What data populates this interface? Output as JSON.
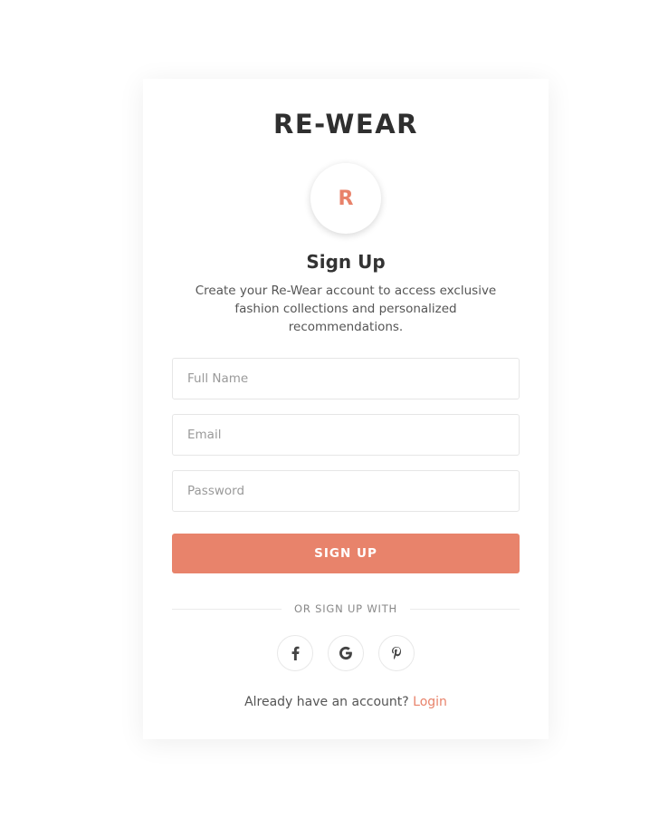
{
  "brand": {
    "name": "RE-WEAR",
    "logo_letter": "R"
  },
  "signup": {
    "title": "Sign Up",
    "subtitle": "Create your Re-Wear account to access exclusive fashion collections and personalized recommendations."
  },
  "form": {
    "full_name": {
      "placeholder": "Full Name",
      "value": ""
    },
    "email": {
      "placeholder": "Email",
      "value": ""
    },
    "password": {
      "placeholder": "Password",
      "value": ""
    },
    "submit_label": "SIGN UP"
  },
  "social": {
    "divider_label": "OR SIGN UP WITH",
    "providers": [
      {
        "icon": "facebook-icon"
      },
      {
        "icon": "google-icon"
      },
      {
        "icon": "pinterest-icon"
      }
    ]
  },
  "footer": {
    "prompt": "Already have an account?",
    "login_label": "Login"
  },
  "colors": {
    "accent": "#e8836b",
    "heading": "#2f2f2f",
    "body_text": "#555555",
    "border": "#e6e6e6"
  }
}
